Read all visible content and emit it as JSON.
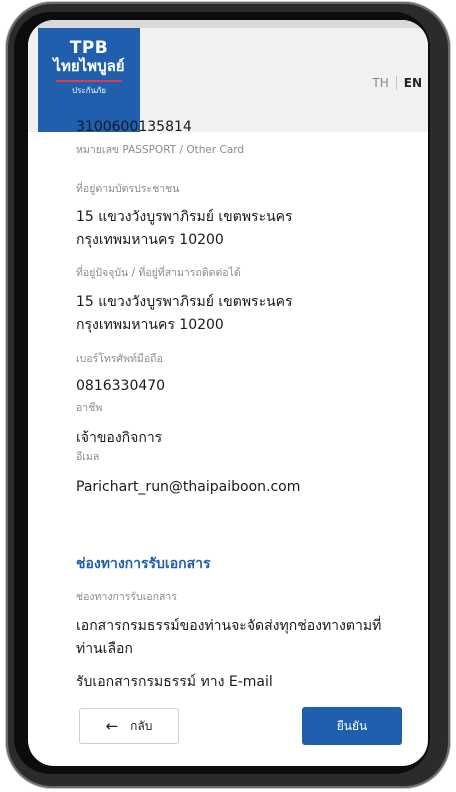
{
  "header": {
    "logo": {
      "brand": "TPB",
      "thai_name": "ไทยไพบูลย์",
      "sub": "ประกันภัย"
    },
    "lang": {
      "th": "TH",
      "en": "EN",
      "active": "EN"
    }
  },
  "fields": {
    "id_number": {
      "value": "3100600135814",
      "label": "หมายเลข PASSPORT / Other Card"
    },
    "id_address": {
      "label": "ที่อยู่ตามบัตรประชาชน",
      "line1": "15 แขวงวังบูรพาภิรมย์ เขตพระนคร",
      "line2": "กรุงเทพมหานคร 10200"
    },
    "current_address": {
      "label": "ที่อยู่ปัจจุบัน / ที่อยู่ที่สามารถติดต่อได้",
      "line1": "15 แขวงวังบูรพาภิรมย์ เขตพระนคร",
      "line2": "กรุงเทพมหานคร 10200"
    },
    "mobile": {
      "label": "เบอร์โทรศัพท์มือถือ",
      "value": "0816330470"
    },
    "occupation": {
      "label": "อาชีพ",
      "value": "เจ้าของกิจการ"
    },
    "email": {
      "label": "อีเมล",
      "value": "Parichart_run@thaipaiboon.com"
    }
  },
  "document_channel": {
    "section_title": "ช่องทางการรับเอกสาร",
    "label": "ช่องทางการรับเอกสาร",
    "line1": "เอกสารกรมธรรม์ของท่านจะจัดส่งทุกช่องทางตามที่",
    "line2": "ท่านเลือก",
    "option": "รับเอกสารกรมธรรม์ ทาง E-mail"
  },
  "buttons": {
    "back": "กลับ",
    "confirm": "ยืนยัน"
  },
  "icons": {
    "back": "arrow-left-icon"
  },
  "colors": {
    "brand_blue": "#1f5fae",
    "logo_red": "#e23a4a",
    "header_bg": "#f1f1f1"
  }
}
